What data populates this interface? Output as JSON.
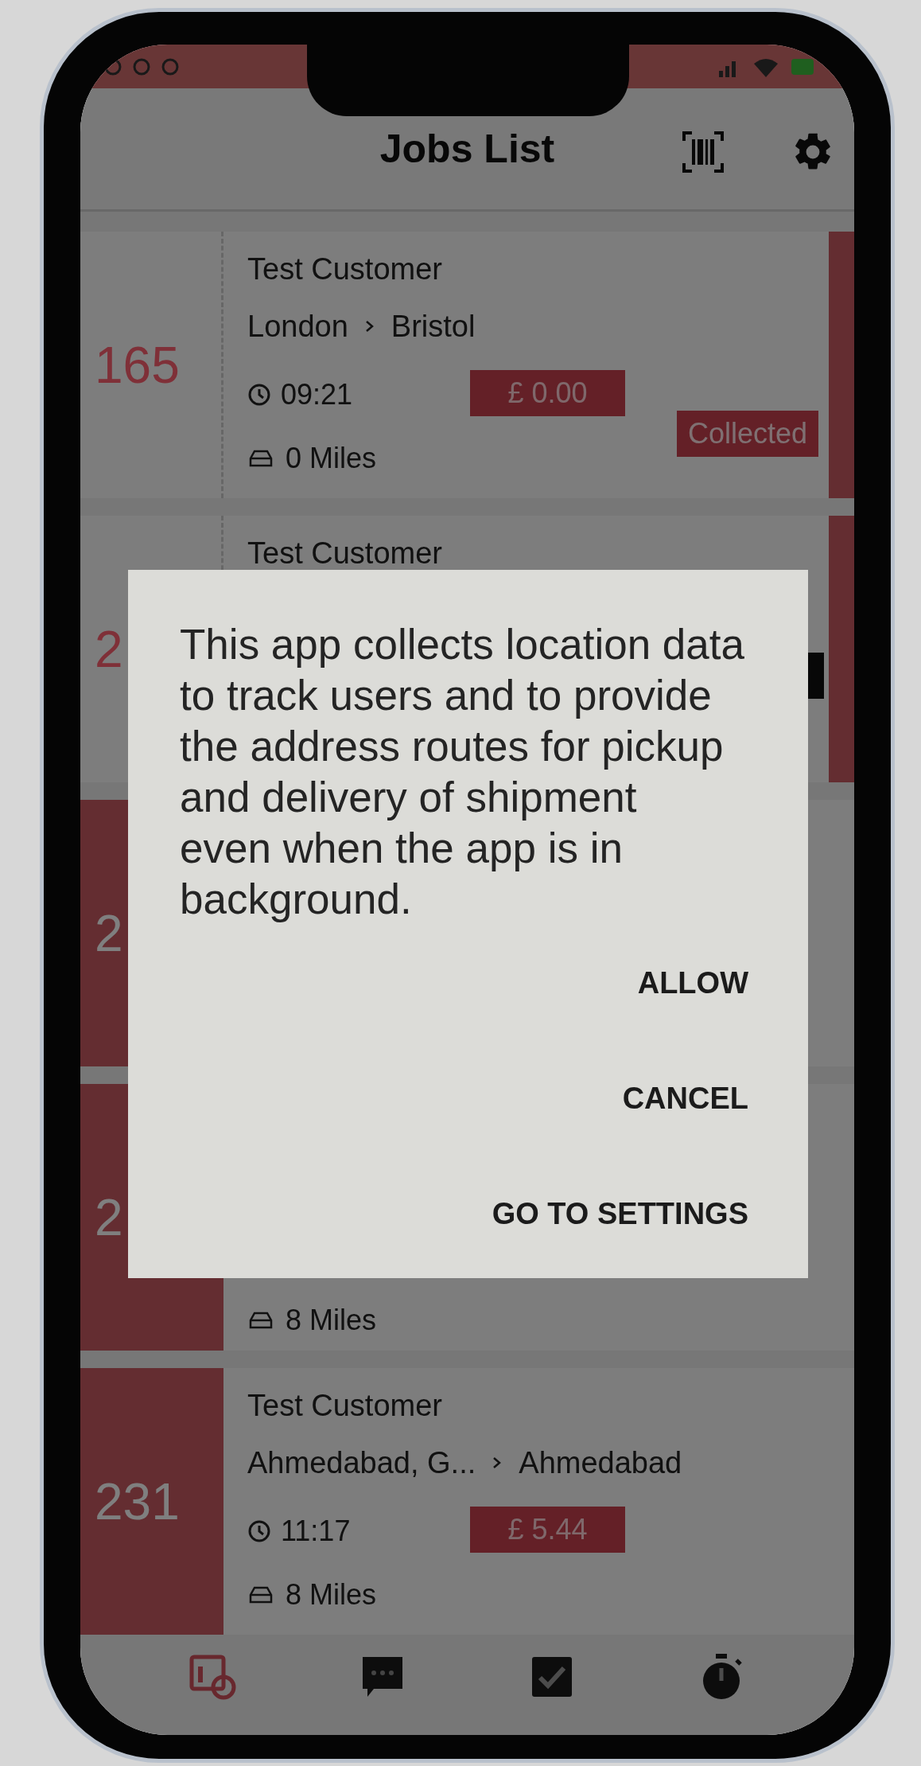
{
  "header": {
    "title": "Jobs List"
  },
  "jobs": [
    {
      "number": "165",
      "customer": "Test Customer",
      "from": "London",
      "to": "Bristol",
      "time": "09:21",
      "price": "£ 0.00",
      "distance": "0 Miles",
      "status": {
        "label": "Collected",
        "kind": "label"
      },
      "highlighted": false,
      "swipe_handle": true
    },
    {
      "number": "2",
      "customer": "Test Customer",
      "status": {
        "kind": "chip"
      },
      "highlighted": false,
      "swipe_handle": true
    },
    {
      "number": "2",
      "highlighted": true,
      "swipe_handle": false
    },
    {
      "number": "2",
      "distance": "8 Miles",
      "highlighted": true,
      "swipe_handle": false
    },
    {
      "number": "231",
      "customer": "Test Customer",
      "from": "Ahmedabad, G...",
      "to": "Ahmedabad",
      "time": "11:17",
      "price": "£ 5.44",
      "distance": "8 Miles",
      "highlighted": true,
      "swipe_handle": false
    }
  ],
  "dialog": {
    "message": "This app collects location data to track users and to provide the address routes for pickup and delivery of shipment\neven when the app is in background.",
    "buttons": [
      "ALLOW",
      "CANCEL",
      "GO TO SETTINGS"
    ]
  },
  "tab_bar": [
    {
      "kind": "schedule",
      "selected": true
    },
    {
      "kind": "chat",
      "selected": false
    },
    {
      "kind": "tasks",
      "selected": false
    },
    {
      "kind": "timer",
      "selected": false
    }
  ]
}
